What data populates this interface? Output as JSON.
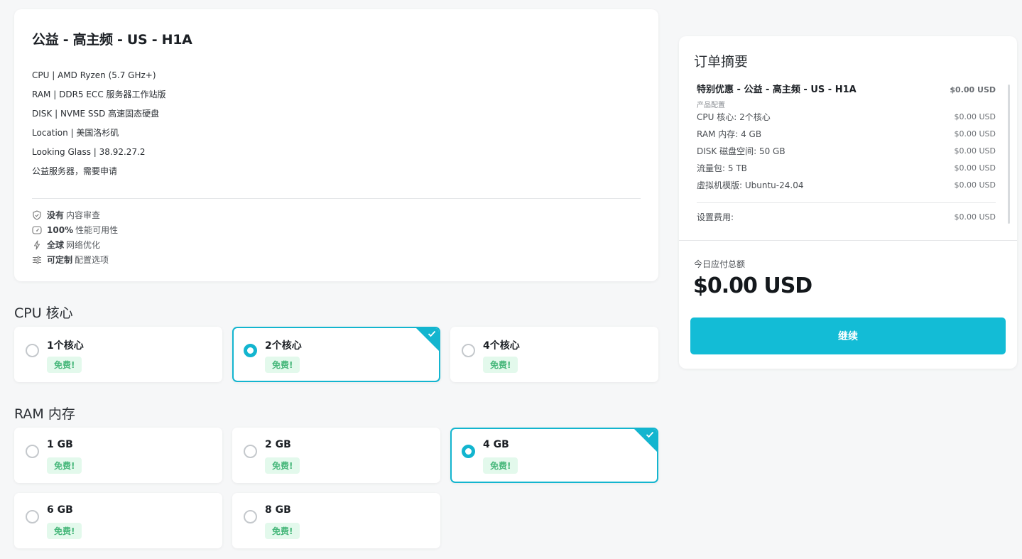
{
  "product": {
    "title": "公益 - 高主频 - US - H1A",
    "specs": [
      "CPU | AMD Ryzen (5.7 GHz+)",
      "RAM | DDR5 ECC 服务器工作站版",
      "DISK | NVME SSD 高速固态硬盘",
      "Location | 美国洛杉矶",
      "Looking Glass | 38.92.27.2",
      "公益服务器，需要申请"
    ],
    "features": [
      {
        "icon": "shield-check-icon",
        "bold": "没有",
        "text": "内容审查"
      },
      {
        "icon": "gauge-icon",
        "bold": "100%",
        "text": "性能可用性"
      },
      {
        "icon": "lightning-icon",
        "bold": "全球",
        "text": "网络优化"
      },
      {
        "icon": "sliders-icon",
        "bold": "可定制",
        "text": "配置选项"
      }
    ]
  },
  "cpu": {
    "title": "CPU 核心",
    "options": [
      {
        "label": "1个核心",
        "badge": "免费!",
        "selected": false
      },
      {
        "label": "2个核心",
        "badge": "免费!",
        "selected": true
      },
      {
        "label": "4个核心",
        "badge": "免费!",
        "selected": false
      }
    ]
  },
  "ram": {
    "title": "RAM 内存",
    "options": [
      {
        "label": "1 GB",
        "badge": "免费!",
        "selected": false
      },
      {
        "label": "2 GB",
        "badge": "免费!",
        "selected": false
      },
      {
        "label": "4 GB",
        "badge": "免费!",
        "selected": true
      },
      {
        "label": "6 GB",
        "badge": "免费!",
        "selected": false
      },
      {
        "label": "8 GB",
        "badge": "免费!",
        "selected": false
      }
    ]
  },
  "summary": {
    "title": "订单摘要",
    "product_line": {
      "label": "特别优惠 - 公益 - 高主频 - US - H1A",
      "price": "$0.00 USD"
    },
    "config_heading": "产品配置",
    "items": [
      {
        "label": "CPU 核心: 2个核心",
        "price": "$0.00 USD"
      },
      {
        "label": "RAM 内存: 4 GB",
        "price": "$0.00 USD"
      },
      {
        "label": "DISK 磁盘空间: 50 GB",
        "price": "$0.00 USD"
      },
      {
        "label": "流量包: 5 TB",
        "price": "$0.00 USD"
      },
      {
        "label": "虚拟机模版: Ubuntu-24.04",
        "price": "$0.00 USD"
      }
    ],
    "setup": {
      "label": "设置费用:",
      "price": "$0.00 USD"
    },
    "total_label": "今日应付总额",
    "total_value": "$0.00 USD",
    "continue_label": "继续"
  },
  "colors": {
    "accent": "#13b5cf",
    "button": "#13bcd6",
    "free_bg": "#e3f9ec",
    "free_text": "#46b77a"
  }
}
